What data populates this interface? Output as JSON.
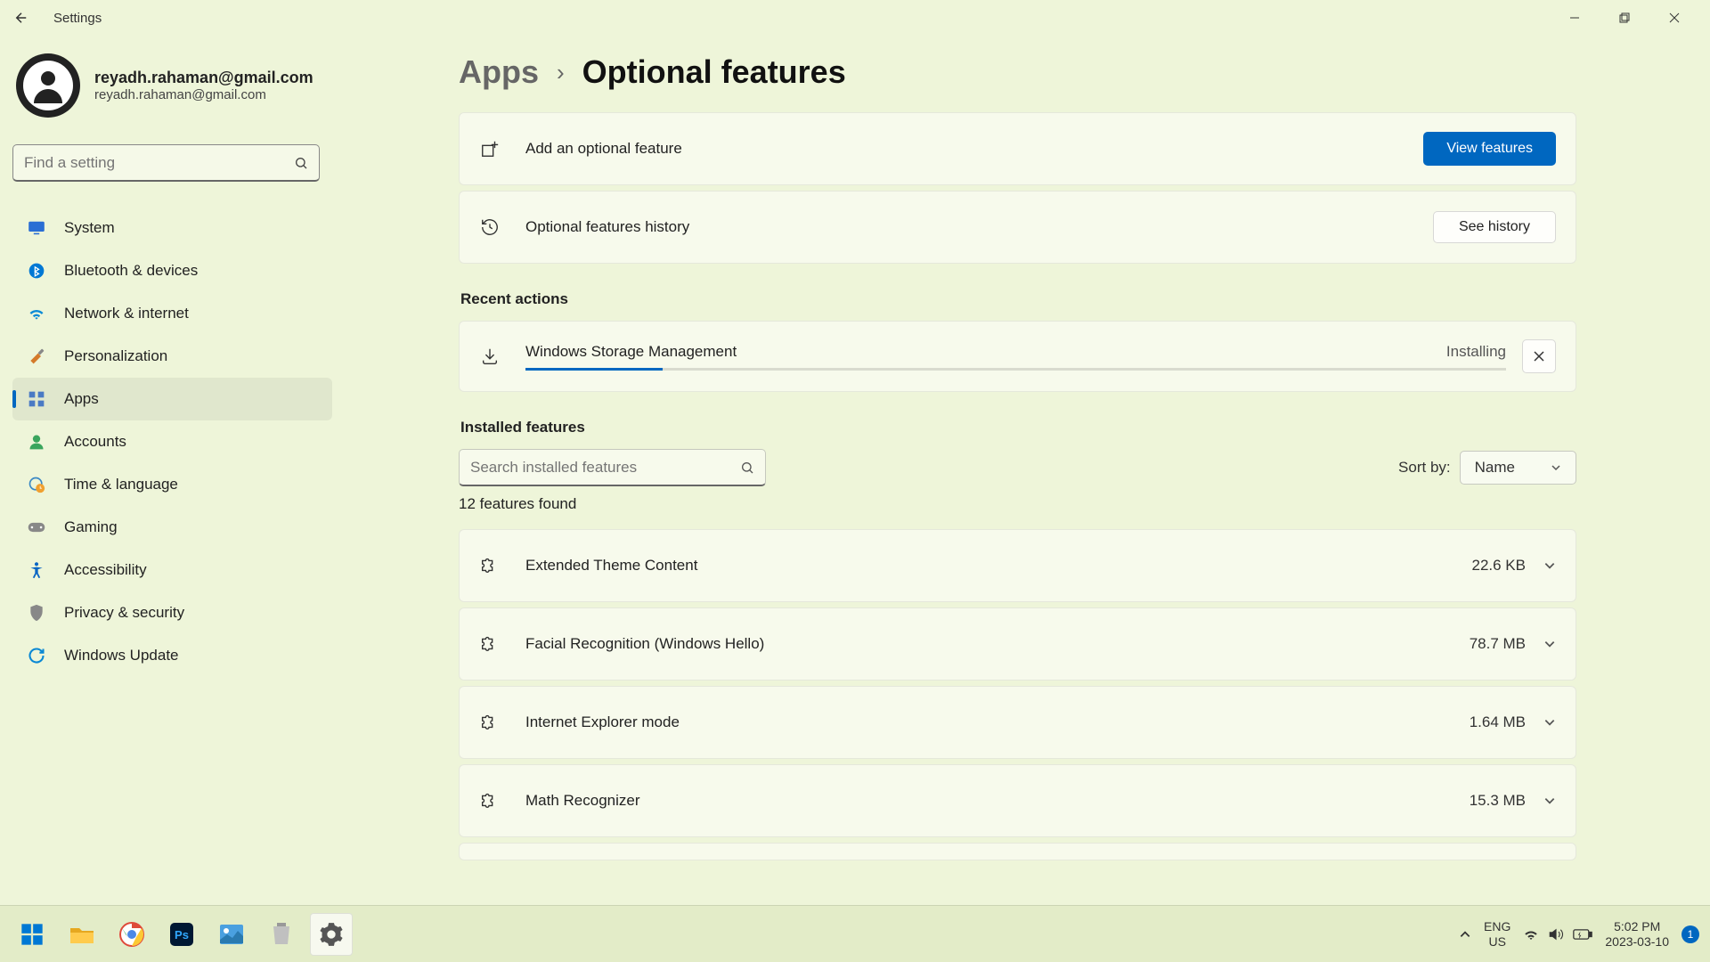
{
  "titlebar": {
    "title": "Settings"
  },
  "profile": {
    "name": "reyadh.rahaman@gmail.com",
    "email": "reyadh.rahaman@gmail.com"
  },
  "search": {
    "placeholder": "Find a setting"
  },
  "nav": {
    "items": [
      {
        "label": "System"
      },
      {
        "label": "Bluetooth & devices"
      },
      {
        "label": "Network & internet"
      },
      {
        "label": "Personalization"
      },
      {
        "label": "Apps"
      },
      {
        "label": "Accounts"
      },
      {
        "label": "Time & language"
      },
      {
        "label": "Gaming"
      },
      {
        "label": "Accessibility"
      },
      {
        "label": "Privacy & security"
      },
      {
        "label": "Windows Update"
      }
    ]
  },
  "breadcrumb": {
    "parent": "Apps",
    "current": "Optional features"
  },
  "cards": {
    "add": {
      "label": "Add an optional feature",
      "button": "View features"
    },
    "history": {
      "label": "Optional features history",
      "button": "See history"
    }
  },
  "sections": {
    "recent": "Recent actions",
    "installed": "Installed features"
  },
  "recent_action": {
    "name": "Windows Storage Management",
    "status": "Installing"
  },
  "features_search": {
    "placeholder": "Search installed features"
  },
  "sort": {
    "label": "Sort by:",
    "value": "Name"
  },
  "count": "12 features found",
  "features": [
    {
      "name": "Extended Theme Content",
      "size": "22.6 KB"
    },
    {
      "name": "Facial Recognition (Windows Hello)",
      "size": "78.7 MB"
    },
    {
      "name": "Internet Explorer mode",
      "size": "1.64 MB"
    },
    {
      "name": "Math Recognizer",
      "size": "15.3 MB"
    }
  ],
  "tray": {
    "lang1": "ENG",
    "lang2": "US",
    "time": "5:02 PM",
    "date": "2023-03-10",
    "badge": "1"
  }
}
